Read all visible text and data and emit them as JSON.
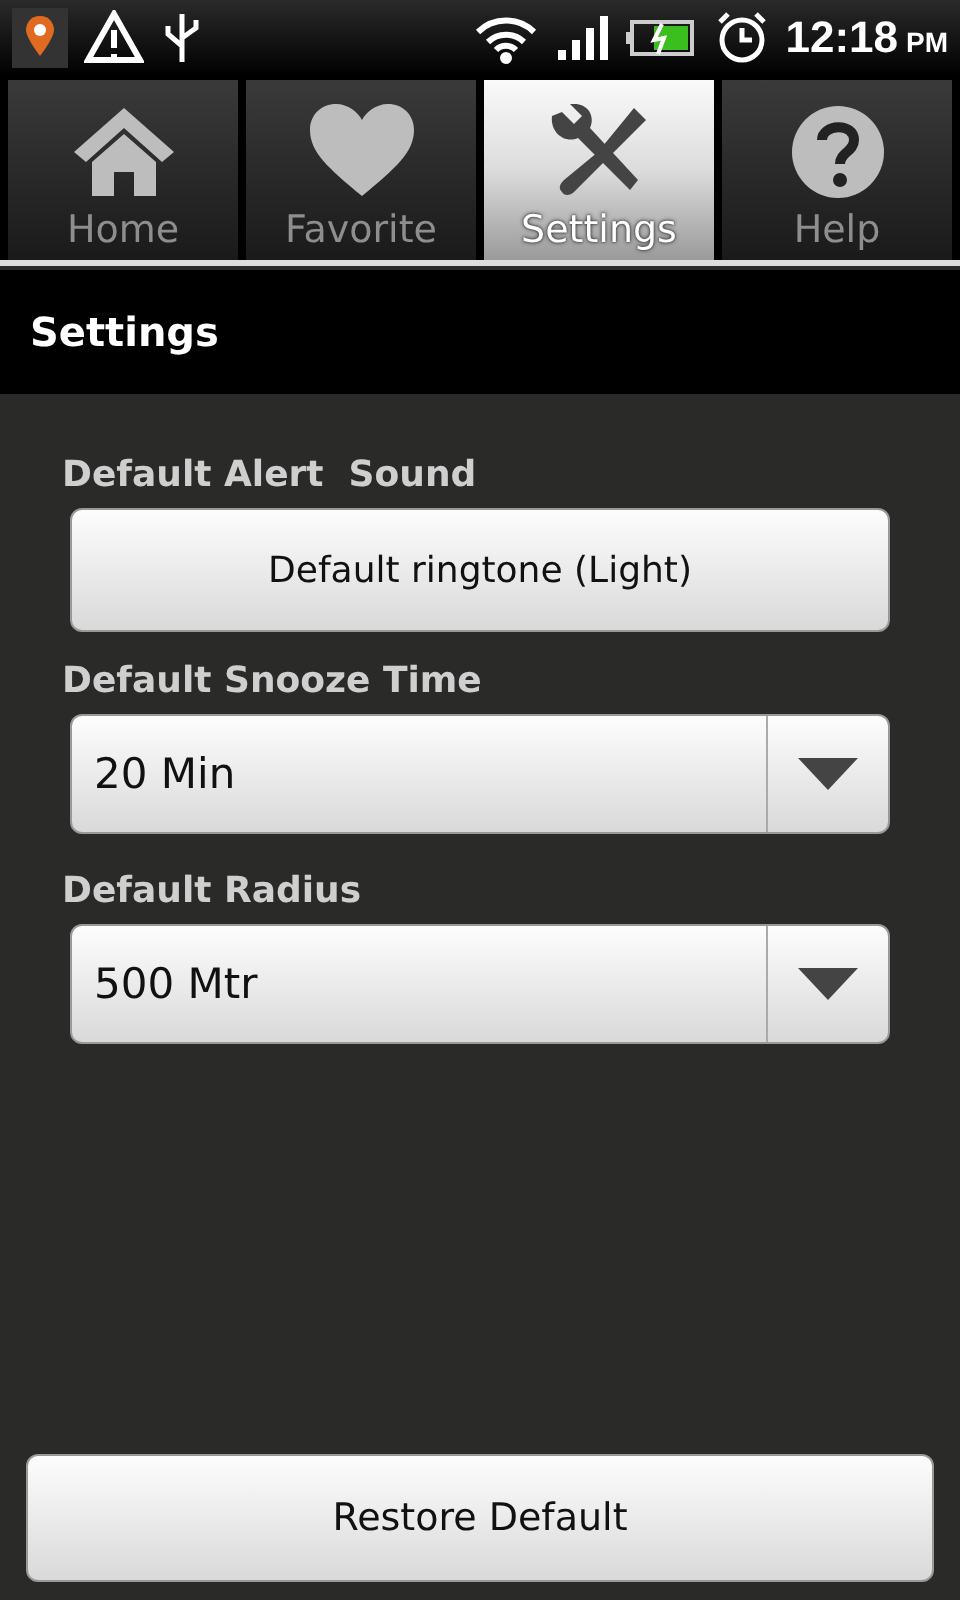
{
  "status_bar": {
    "time": "12:18",
    "ampm": "PM"
  },
  "tabs": [
    {
      "label": "Home",
      "selected": false
    },
    {
      "label": "Favorite",
      "selected": false
    },
    {
      "label": "Settings",
      "selected": true
    },
    {
      "label": "Help",
      "selected": false
    }
  ],
  "header": {
    "title": "Settings"
  },
  "settings": [
    {
      "label": "Default Alert  Sound",
      "kind": "button",
      "value": "Default ringtone (Light)"
    },
    {
      "label": "Default Snooze Time",
      "kind": "dropdown",
      "value": "20 Min"
    },
    {
      "label": "Default Radius",
      "kind": "dropdown",
      "value": "500 Mtr"
    }
  ],
  "footer_button": "Restore Default"
}
